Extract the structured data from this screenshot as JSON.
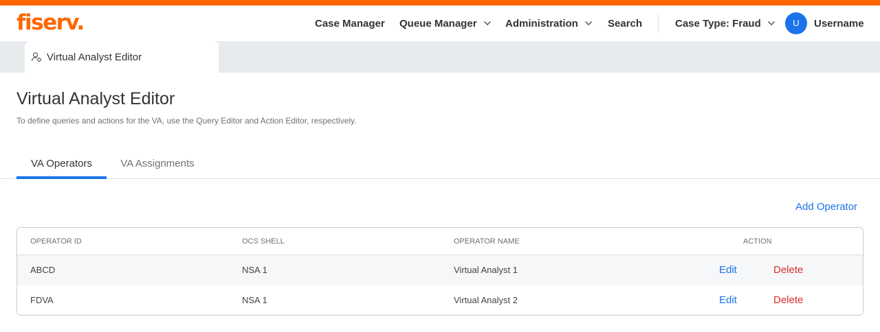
{
  "brand": {
    "logo_text": "fiserv.",
    "color": "#ff6600"
  },
  "header": {
    "nav": [
      {
        "label": "Case Manager",
        "has_dropdown": false
      },
      {
        "label": "Queue Manager",
        "has_dropdown": true
      },
      {
        "label": "Administration",
        "has_dropdown": true
      },
      {
        "label": "Search",
        "has_dropdown": false
      },
      {
        "label": "Case Type: Fraud",
        "has_dropdown": true
      }
    ],
    "user": {
      "initial": "U",
      "name": "Username"
    }
  },
  "doc_tab": {
    "label": "Virtual Analyst Editor",
    "icon": "user-gear-icon"
  },
  "page": {
    "title": "Virtual Analyst Editor",
    "subtitle": "To define queries and actions for the VA, use the Query Editor and Action Editor, respectively."
  },
  "tabs": [
    {
      "label": "VA Operators",
      "active": true
    },
    {
      "label": "VA Assignments",
      "active": false
    }
  ],
  "add_operator_label": "Add Operator",
  "table": {
    "columns": [
      "OPERATOR ID",
      "OCS SHELL",
      "OPERATOR NAME",
      "ACTION"
    ],
    "rows": [
      {
        "operator_id": "ABCD",
        "ocs_shell": "NSA 1",
        "operator_name": "Virtual Analyst 1",
        "edit": "Edit",
        "delete": "Delete"
      },
      {
        "operator_id": "FDVA",
        "ocs_shell": "NSA 1",
        "operator_name": "Virtual Analyst 2",
        "edit": "Edit",
        "delete": "Delete"
      }
    ]
  },
  "colors": {
    "accent": "#1a73e8",
    "danger": "#d32f2f",
    "brand": "#ff6600"
  }
}
